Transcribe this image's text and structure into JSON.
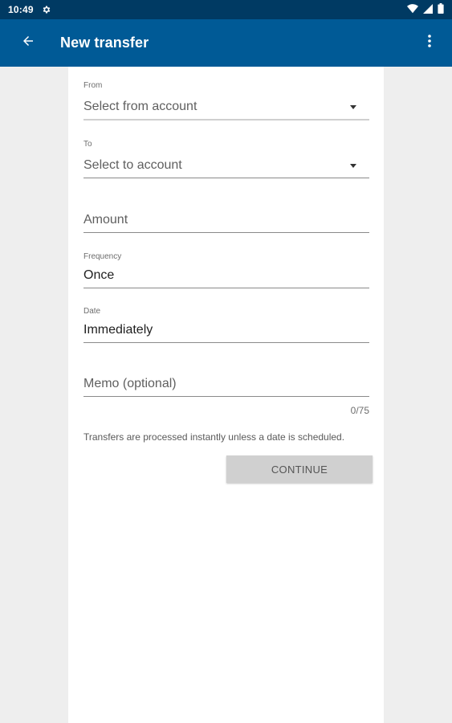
{
  "status_bar": {
    "time": "10:49"
  },
  "app_bar": {
    "title": "New transfer"
  },
  "form": {
    "from": {
      "label": "From",
      "placeholder": "Select from account"
    },
    "to": {
      "label": "To",
      "placeholder": "Select to account"
    },
    "amount": {
      "placeholder": "Amount"
    },
    "frequency": {
      "label": "Frequency",
      "value": "Once"
    },
    "date": {
      "label": "Date",
      "value": "Immediately"
    },
    "memo": {
      "placeholder": "Memo (optional)",
      "counter": "0/75"
    },
    "helper_text": "Transfers are processed instantly unless a date is scheduled.",
    "continue_label": "CONTINUE"
  },
  "icons": {
    "back": "arrow-left-icon",
    "more": "more-vert-icon",
    "settings": "gear-icon",
    "wifi": "wifi-icon",
    "signal": "signal-icon",
    "battery": "battery-icon"
  },
  "colors": {
    "status_bar": "#003a63",
    "app_bar": "#005a96",
    "button_disabled": "#d0d0d0"
  }
}
